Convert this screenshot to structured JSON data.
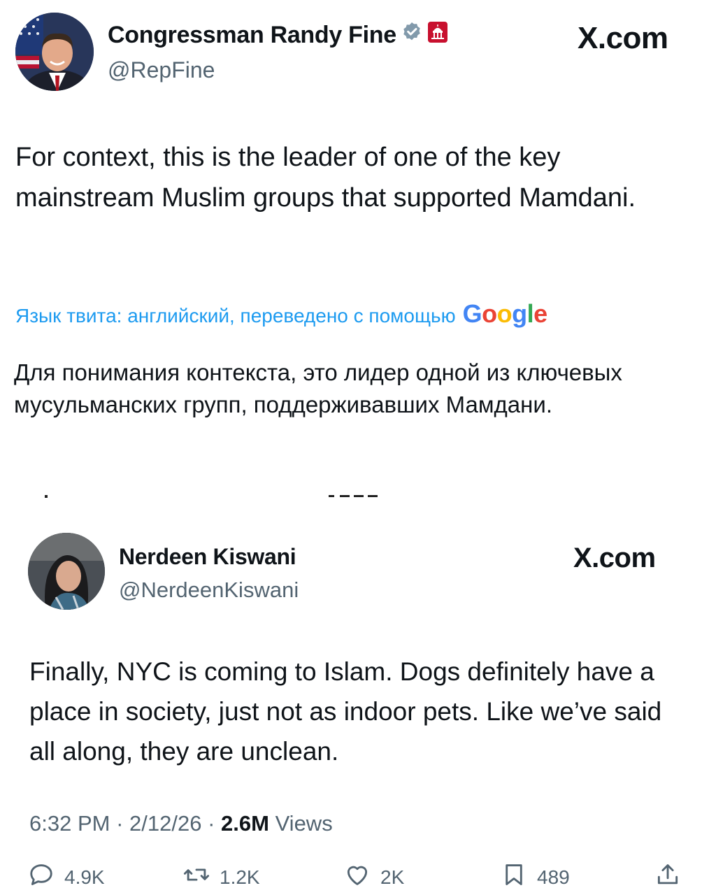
{
  "tweet1": {
    "author_name": "Congressman Randy Fine",
    "handle": "@RepFine",
    "site": "X.com",
    "text": "For context, this is the leader of one of the key mainstream Muslim groups that supported Mamdani.",
    "translate_note": "Язык твита: английский, переведено с помощью",
    "translate_provider": "Google",
    "translated_text": "Для понимания контекста, это лидер одной из ключевых мусульманских групп, поддерживавших Мамдани."
  },
  "tweet2": {
    "author_name": "Nerdeen Kiswani",
    "handle": "@NerdeenKiswani",
    "site": "X.com",
    "text": "Finally, NYC is coming to Islam. Dogs definitely have a place in society, just not as indoor pets. Like we’ve said all along, they are unclean.",
    "time": "6:32 PM",
    "date": "2/12/26",
    "views_count": "2.6M",
    "views_label": "Views",
    "sep": " · ",
    "replies": "4.9K",
    "reposts": "1.2K",
    "likes": "2K",
    "bookmarks": "489"
  },
  "colors": {
    "accent": "#1d9bf0",
    "secondary_text": "#536471",
    "verified": "#829aab",
    "badge": "#c8102e"
  },
  "icons": [
    "verified-badge-icon",
    "capitol-badge-icon",
    "reply-icon",
    "repost-icon",
    "like-icon",
    "bookmark-icon",
    "share-icon"
  ]
}
